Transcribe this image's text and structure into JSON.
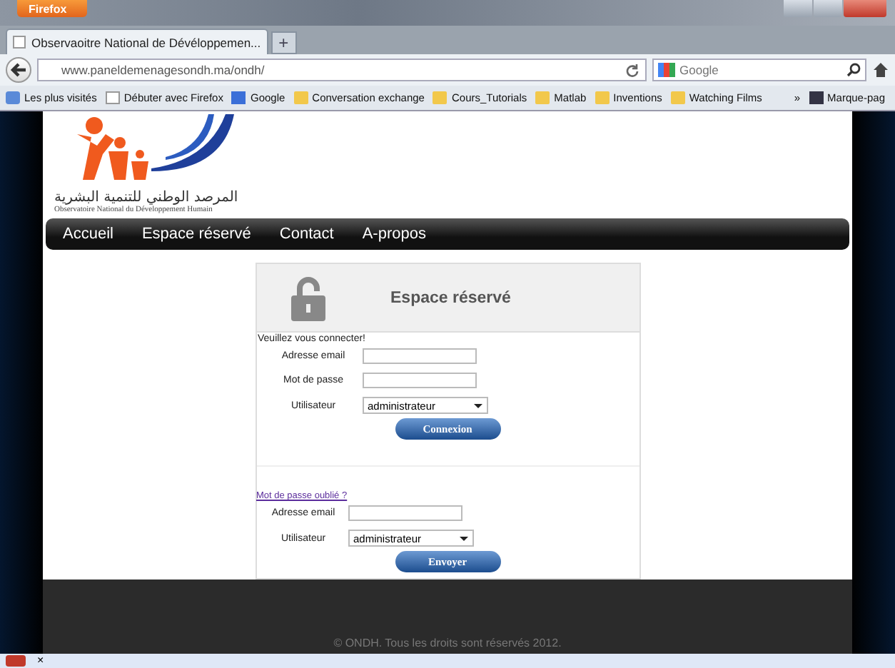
{
  "browser": {
    "menu_button": "Firefox",
    "tabs": [
      {
        "label": "Observaoitre National de Dévéloppemen...",
        "selected": true
      }
    ],
    "new_tab": "+",
    "url": "www.paneldemenagesondh.ma/ondh/",
    "search": {
      "placeholder": "Google"
    },
    "bookmarks": [
      {
        "label": "Les plus visités",
        "kind": "special"
      },
      {
        "label": "Débuter avec Firefox",
        "kind": "page"
      },
      {
        "label": "Google",
        "kind": "google"
      },
      {
        "label": "Conversation exchange",
        "kind": "folder"
      },
      {
        "label": "Cours_Tutorials",
        "kind": "folder"
      },
      {
        "label": "Matlab",
        "kind": "folder"
      },
      {
        "label": "Inventions",
        "kind": "folder"
      },
      {
        "label": "Watching Films",
        "kind": "folder"
      }
    ],
    "more": "»",
    "bookmarks_menu": "Marque-pag"
  },
  "site": {
    "logo_arabic": "المرصد الوطني للتنمية البشرية",
    "logo_subtitle": "Observatoire National du Développement Humain",
    "nav": [
      "Accueil",
      "Espace réservé",
      "Contact",
      "A-propos"
    ],
    "panel_title": "Espace réservé",
    "prompt": "Veuillez vous connecter!",
    "login_fields": [
      {
        "label": "Adresse email",
        "kind": "input"
      },
      {
        "label": "Mot de passe",
        "kind": "input"
      },
      {
        "label": "Utilisateur",
        "kind": "select",
        "value": "administrateur"
      }
    ],
    "login_button": "Connexion",
    "forgot_link": "Mot de passe oublié ?",
    "reset_fields": [
      {
        "label": "Adresse email",
        "kind": "input"
      },
      {
        "label": "Utilisateur",
        "kind": "select",
        "value": "administrateur"
      }
    ],
    "reset_button": "Envoyer",
    "footer": "© ONDH. Tous les droits sont réservés 2012."
  },
  "status_bar": {
    "close": "×"
  }
}
